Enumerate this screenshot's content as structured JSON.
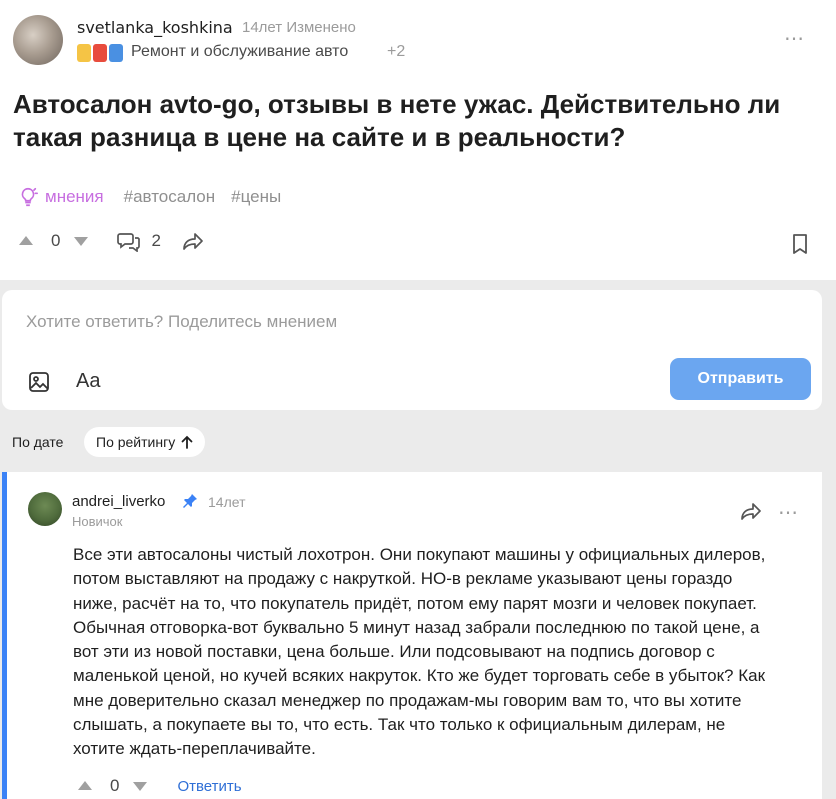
{
  "post": {
    "author": "svetlanka_koshkina",
    "time": "14лет Изменено",
    "category": "Ремонт и обслуживание авто",
    "category_more": "+2",
    "category_badge_colors": [
      "#f5c445",
      "#e84c3d",
      "#4a90e2"
    ],
    "more_icon": "⋯",
    "title": "Автосалон avto-go, отзывы в нете ужас. Действительно ли такая разница в цене на сайте и в реальности?",
    "tag_main": "мнения",
    "tags": [
      "#автосалон",
      "#цены"
    ],
    "score": "0",
    "comments_count": "2"
  },
  "reply": {
    "placeholder": "Хотите ответить? Поделитесь мнением",
    "font_label": "Aa",
    "send_label": "Отправить"
  },
  "sort": {
    "by_date": "По дате",
    "by_rating": "По рейтингу"
  },
  "comment": {
    "author": "andrei_liverko",
    "time": "14лет",
    "rank": "Новичок",
    "text": "Все эти автосалоны чистый лохотрон. Они покупают машины у официальных дилеров,\nпотом выставляют на продажу с накруткой. НО-в рекламе указывают цены гораздо\nниже, расчёт на то, что покупатель придёт, потом ему парят мозги и человек покупает.\nОбычная отговорка-вот буквально 5 минут назад забрали последнюю по такой цене, а\nвот эти из новой поставки, цена больше. Или подсовывают на подпись договор с\nмаленькой ценой, но кучей всяких накруток. Кто же будет торговать себе в убыток? Как\nмне доверительно сказал менеджер по продажам-мы говорим вам то, что вы хотите\nслышать, а покупаете вы то, что есть. Так что только к официальным дилерам, не\nхотите ждать-переплачивайте.",
    "score": "0",
    "reply_label": "Ответить",
    "more_icon": "⋯"
  },
  "colors": {
    "accent": "#3b82f6",
    "send_button": "#6ba6f0",
    "tag_main": "#c76ee0"
  }
}
